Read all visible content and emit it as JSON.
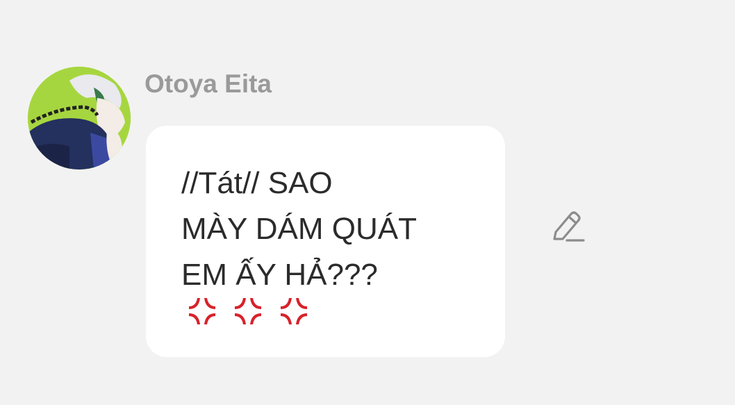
{
  "message": {
    "sender_name": "Otoya Eita",
    "lines": [
      "//Tát// SAO",
      "MÀY DÁM QUÁT",
      "EM ẤY HẢ???"
    ],
    "emoji": [
      "anger-symbol",
      "anger-symbol",
      "anger-symbol"
    ],
    "emoji_color": "#d8212a"
  },
  "actions": {
    "edit_icon": "pencil-edit-icon"
  },
  "colors": {
    "background": "#f2f2f2",
    "bubble": "#ffffff",
    "name": "#9a9a9a",
    "text": "#2b2b2b",
    "avatar_bg": "#a6d63f"
  }
}
